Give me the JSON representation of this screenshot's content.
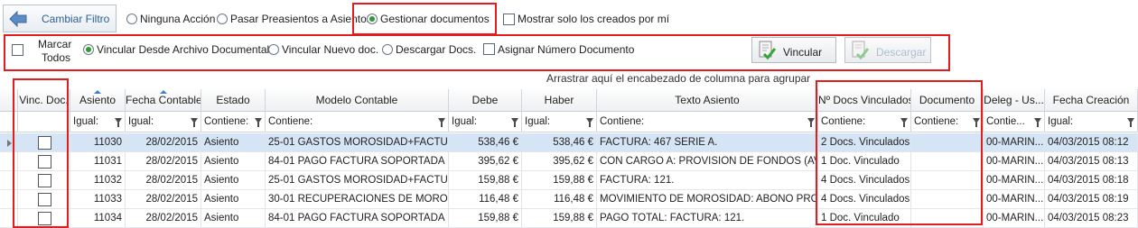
{
  "toolbar": {
    "back_label": "Cambiar Filtro",
    "radio_none": "Ninguna Acción",
    "radio_preasientos": "Pasar Preasientos a Asientos",
    "radio_gestionar": "Gestionar documentos",
    "check_mine": "Mostrar solo los creados por mí"
  },
  "actions": {
    "marcar_todos_line1": "Marcar",
    "marcar_todos_line2": "Todos",
    "radio_vincular_archivo": "Vincular Desde Archivo Documental",
    "radio_vincular_nuevo": "Vincular Nuevo doc.",
    "radio_descargar": "Descargar Docs.",
    "check_asignar": "Asignar Número Documento",
    "btn_vincular": "Vincular",
    "btn_descargar": "Descargar"
  },
  "group_hint": "Arrastrar aquí el encabezado de columna para agrupar",
  "columns": [
    "Vinc. Doc.",
    "Asiento",
    "Fecha Contable",
    "Estado",
    "Modelo Contable",
    "Debe",
    "Haber",
    "Texto Asiento",
    "Nº Docs Vinculados",
    "Documento",
    "Deleg - Us...",
    "Fecha Creación"
  ],
  "filters": [
    "",
    "Igual:",
    "Igual:",
    "Contiene:",
    "Contiene:",
    "Igual:",
    "Igual:",
    "Contiene:",
    "Contiene:",
    "Contiene:",
    "Contie...",
    "Igual:"
  ],
  "rows": [
    [
      "",
      "11030",
      "28/02/2015",
      "Asiento",
      "25-01   GASTOS MOROSIDAD+FACTU...",
      "538,46 €",
      "538,46 €",
      "FACTURA: 467 SERIE A.",
      "2 Docs. Vinculados",
      "",
      "00-MARIN...",
      "04/03/2015 08:12"
    ],
    [
      "",
      "11031",
      "28/02/2015",
      "Asiento",
      "84-01   PAGO FACTURA SOPORTADA",
      "395,62 €",
      "395,62 €",
      "CON CARGO A: PROVISION DE FONDOS (AVA...",
      "1 Doc. Vinculado",
      "",
      "00-MARIN...",
      "04/03/2015 08:13"
    ],
    [
      "",
      "11032",
      "28/02/2015",
      "Asiento",
      "25-01   GASTOS MOROSIDAD+FACTU...",
      "159,88 €",
      "159,88 €",
      "FACTURA: 121.",
      "4 Docs. Vinculados",
      "",
      "00-MARIN...",
      "04/03/2015 08:18"
    ],
    [
      "",
      "11033",
      "28/02/2015",
      "Asiento",
      "30-01   RECUPERACIONES DE MOROS...",
      "116,48 €",
      "116,48 €",
      "MOVIMIENTO DE MOROSIDAD: ABONO PRO...",
      "4 Docs. Vinculados",
      "",
      "00-MARIN...",
      "04/03/2015 08:19"
    ],
    [
      "",
      "11034",
      "28/02/2015",
      "Asiento",
      "84-01   PAGO FACTURA SOPORTADA",
      "159,88 €",
      "159,88 €",
      "PAGO TOTAL: FACTURA: 121.",
      "1 Doc. Vinculado",
      "",
      "00-MARIN...",
      "04/03/2015 08:23"
    ]
  ]
}
